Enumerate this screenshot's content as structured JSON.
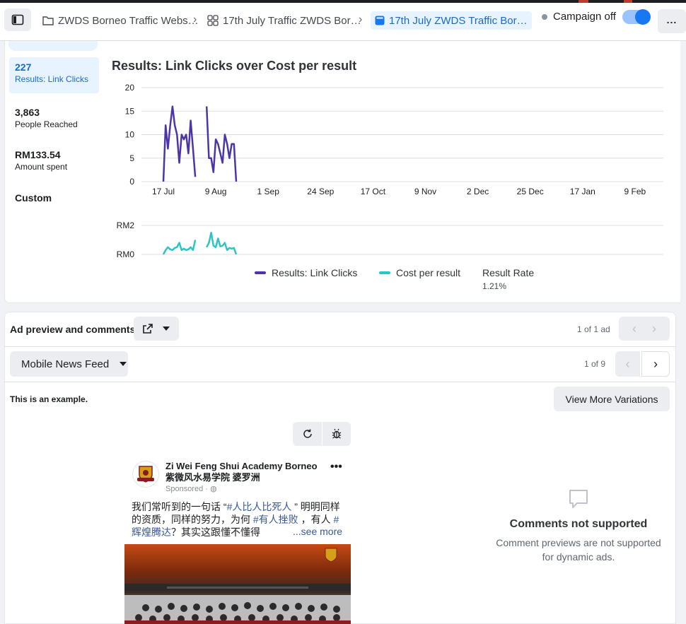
{
  "header": {
    "breadcrumbs": [
      {
        "label": "ZWDS Borneo Traffic Webs…",
        "icon": "folder-icon"
      },
      {
        "label": "17th July Traffic ZWDS Bor…",
        "icon": "grid-icon"
      },
      {
        "label": "17th July ZWDS Traffic Bor…",
        "icon": "ad-icon"
      }
    ],
    "campaign_status": "Campaign off",
    "more_label": "..."
  },
  "metrics": [
    {
      "value": "227",
      "label": "Results: Link Clicks",
      "selected": true
    },
    {
      "value": "3,863",
      "label": "People Reached"
    },
    {
      "value": "RM133.54",
      "label": "Amount spent"
    },
    {
      "value": "Custom",
      "label": ""
    }
  ],
  "chart_data": {
    "type": "line",
    "title": "Results: Link Clicks over Cost per result",
    "top_chart": {
      "yticks": [
        "20",
        "15",
        "10",
        "5",
        "0"
      ],
      "ylim": [
        0,
        20
      ],
      "xticks": [
        "17 Jul",
        "9 Aug",
        "1 Sep",
        "24 Sep",
        "17 Oct",
        "9 Nov",
        "2 Dec",
        "25 Dec",
        "17 Jan",
        "9 Feb"
      ],
      "series": [
        {
          "name": "Results: Link Clicks",
          "color": "#4d35a8",
          "x": [
            0,
            1,
            2,
            3,
            4,
            5,
            6,
            7,
            8,
            9,
            10,
            11,
            12,
            13,
            14,
            15,
            16,
            17,
            18,
            19,
            20,
            21,
            22,
            23,
            24,
            25,
            26,
            27,
            28,
            29,
            30,
            31,
            32
          ],
          "values": [
            0,
            12,
            7,
            12,
            16,
            12,
            10,
            4,
            10,
            9,
            10,
            6,
            13,
            7,
            1,
            null,
            null,
            null,
            null,
            16,
            5,
            5,
            2,
            9,
            8,
            6,
            4,
            10,
            8,
            5,
            8,
            8,
            0
          ]
        }
      ]
    },
    "bottom_chart": {
      "yticks": [
        "RM2",
        "RM0"
      ],
      "series": [
        {
          "name": "Cost per result",
          "color": "#2ec4c4",
          "x": [
            0,
            1,
            2,
            3,
            4,
            5,
            6,
            7,
            8,
            9,
            10,
            11,
            12,
            13,
            14,
            15,
            16,
            17,
            18,
            19,
            20,
            21,
            22,
            23,
            24,
            25,
            26,
            27,
            28,
            29,
            30,
            31,
            32
          ],
          "values": [
            0,
            0.3,
            0.5,
            0.35,
            0.3,
            0.45,
            0.5,
            0.8,
            0.3,
            0.4,
            0.3,
            0.35,
            0.5,
            0.3,
            1.0,
            null,
            null,
            null,
            null,
            0.5,
            0.8,
            1.5,
            0.6,
            0.5,
            1.1,
            0.55,
            0.6,
            0.8,
            0.3,
            0.45,
            0.4,
            0.45,
            0
          ]
        }
      ]
    },
    "legend": [
      "Results: Link Clicks",
      "Cost per result",
      "Result Rate"
    ],
    "result_rate": "1.21%"
  },
  "ad_preview": {
    "title": "Ad preview and comments",
    "ad_pager": "1 of 1 ad",
    "placement": "Mobile News Feed",
    "variation_pager": "1 of 9",
    "example_note": "This is an example.",
    "view_more": "View More Variations",
    "post": {
      "page_name": "Zi Wei Feng Shui Academy Borneo 紫微风水易学院 婆罗洲",
      "sponsored": "Sponsored · ",
      "text_1": "我们常听到的一句话 “",
      "tag_1": "#人比人比死人",
      "text_2": " ” 明明同样的资质，同样的努力，为何 ",
      "tag_2": "#有人挫败",
      "text_3": " ，有人 ",
      "tag_3": "#辉煌腾达",
      "text_4": "？其实这跟懂不懂得",
      "see_more": "...see more"
    },
    "comments": {
      "title": "Comments not supported",
      "text": "Comment previews are not supported for dynamic ads."
    }
  }
}
